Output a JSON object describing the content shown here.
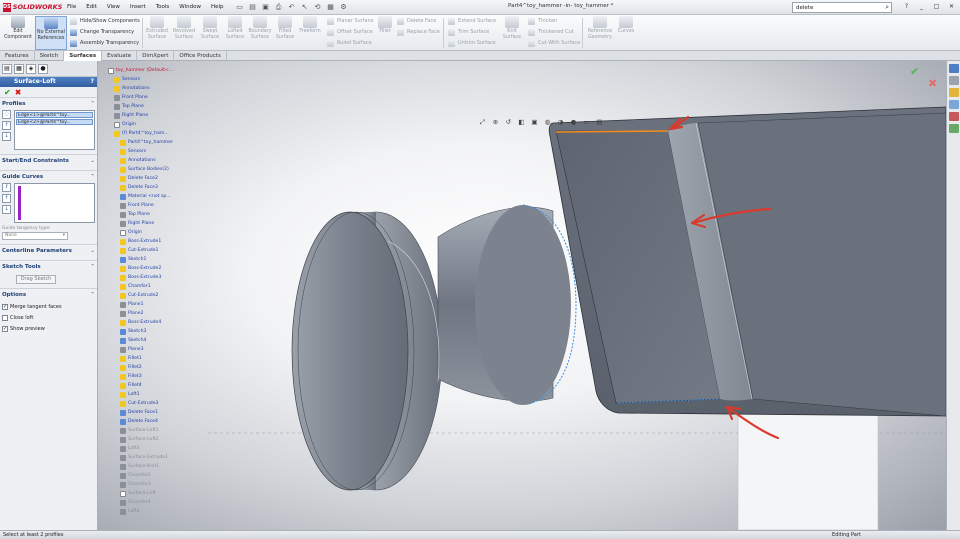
{
  "app": {
    "logo_text": "SOLIDWORKS",
    "window_title": "Part4^toy_hammer -in- toy_hammer *",
    "menu": [
      "File",
      "Edit",
      "View",
      "Insert",
      "Tools",
      "Window",
      "Help"
    ],
    "search_value": "delete",
    "window_buttons": [
      "?",
      "_",
      "□",
      "✕"
    ]
  },
  "command_manager": {
    "edit_component": "Edit Component",
    "no_external_refs": "No External References",
    "hide_show": "Hide/Show Components",
    "change_transparency": "Change Transparency",
    "assembly_transparency": "Assembly Transparency",
    "extruded_surface": "Extruded Surface",
    "revolved_surface": "Revolved Surface",
    "swept_surface": "Swept Surface",
    "lofted_surface": "Lofted Surface",
    "boundary_surface": "Boundary Surface",
    "filled_surface": "Filled Surface",
    "freeform": "Freeform",
    "planar_surface": "Planar Surface",
    "offset_surface": "Offset Surface",
    "ruled_surface": "Ruled Surface",
    "fillet": "Fillet",
    "delete_face": "Delete Face",
    "replace_face": "Replace Face",
    "extend_surface": "Extend Surface",
    "trim_surface": "Trim Surface",
    "untrim_surface": "Untrim Surface",
    "knit_surface": "Knit Surface",
    "thicken": "Thicken",
    "thickened_cut": "Thickened Cut",
    "cut_with_surface": "Cut With Surface",
    "reference_geometry": "Reference Geometry",
    "curves": "Curves"
  },
  "tabs": [
    "Features",
    "Sketch",
    "Surfaces",
    "Evaluate",
    "DimXpert",
    "Office Products"
  ],
  "active_tab": "Surfaces",
  "property_manager": {
    "title": "Surface-Loft",
    "help": "?",
    "profiles_header": "Profiles",
    "profiles": [
      "Edge<1>@Part4^toy...",
      "Edge<2>@Part4^toy..."
    ],
    "start_end_header": "Start/End Constraints",
    "guide_curves_header": "Guide Curves",
    "guide_influence_label": "Guide tangency type:",
    "guide_influence_value": "None",
    "centerline_header": "Centerline Parameters",
    "sketch_tools_header": "Sketch Tools",
    "drag_sketch": "Drag Sketch",
    "options_header": "Options",
    "options": [
      {
        "label": "Merge tangent faces",
        "checked": true
      },
      {
        "label": "Close loft",
        "checked": false
      },
      {
        "label": "Show preview",
        "checked": true
      }
    ]
  },
  "feature_tree": [
    {
      "label": "toy_hammer (Default<...",
      "icon": "w",
      "style": "hl"
    },
    {
      "label": "Sensors",
      "icon": "y",
      "style": "n"
    },
    {
      "label": "Annotations",
      "icon": "y",
      "style": "n"
    },
    {
      "label": "Front Plane",
      "icon": "g",
      "style": "n"
    },
    {
      "label": "Top Plane",
      "icon": "g",
      "style": "n"
    },
    {
      "label": "Right Plane",
      "icon": "g",
      "style": "n"
    },
    {
      "label": "Origin",
      "icon": "w",
      "style": "n"
    },
    {
      "label": "(f) Part4^toy_ham...",
      "icon": "y",
      "style": "n"
    },
    {
      "label": "Part4^toy_hammer",
      "icon": "y",
      "style": "n"
    },
    {
      "label": "Sensors",
      "icon": "y",
      "style": "n"
    },
    {
      "label": "Annotations",
      "icon": "y",
      "style": "n"
    },
    {
      "label": "Surface Bodies(2)",
      "icon": "y",
      "style": "n"
    },
    {
      "label": "Delete Face2",
      "icon": "y",
      "style": "n"
    },
    {
      "label": "Delete Face3",
      "icon": "y",
      "style": "n"
    },
    {
      "label": "Material <not sp...",
      "icon": "b",
      "style": "n"
    },
    {
      "label": "Front Plane",
      "icon": "g",
      "style": "n"
    },
    {
      "label": "Top Plane",
      "icon": "g",
      "style": "n"
    },
    {
      "label": "Right Plane",
      "icon": "g",
      "style": "n"
    },
    {
      "label": "Origin",
      "icon": "w",
      "style": "n"
    },
    {
      "label": "Boss-Extrude1",
      "icon": "y",
      "style": "n"
    },
    {
      "label": "Cut-Extrude1",
      "icon": "y",
      "style": "n"
    },
    {
      "label": "Sketch1",
      "icon": "b",
      "style": "n"
    },
    {
      "label": "Boss-Extrude2",
      "icon": "y",
      "style": "n"
    },
    {
      "label": "Boss-Extrude3",
      "icon": "y",
      "style": "n"
    },
    {
      "label": "Chamfer1",
      "icon": "y",
      "style": "n"
    },
    {
      "label": "Cut-Extrude2",
      "icon": "y",
      "style": "n"
    },
    {
      "label": "Plane1",
      "icon": "g",
      "style": "n"
    },
    {
      "label": "Plane2",
      "icon": "g",
      "style": "n"
    },
    {
      "label": "Boss-Extrude4",
      "icon": "y",
      "style": "n"
    },
    {
      "label": "Sketch3",
      "icon": "b",
      "style": "n"
    },
    {
      "label": "Sketch4",
      "icon": "b",
      "style": "n"
    },
    {
      "label": "Plane3",
      "icon": "g",
      "style": "n"
    },
    {
      "label": "Fillet1",
      "icon": "y",
      "style": "n"
    },
    {
      "label": "Fillet2",
      "icon": "y",
      "style": "n"
    },
    {
      "label": "Fillet3",
      "icon": "y",
      "style": "n"
    },
    {
      "label": "Fillet4",
      "icon": "y",
      "style": "n"
    },
    {
      "label": "Loft1",
      "icon": "y",
      "style": "n"
    },
    {
      "label": "Cut-Extrude3",
      "icon": "y",
      "style": "n"
    },
    {
      "label": "Delete Face1",
      "icon": "b",
      "style": "n"
    },
    {
      "label": "Delete Face4",
      "icon": "b",
      "style": "n"
    },
    {
      "label": "Surface-Loft1",
      "icon": "g",
      "style": "f"
    },
    {
      "label": "Surface-Loft2",
      "icon": "g",
      "style": "f"
    },
    {
      "label": "Loft3",
      "icon": "g",
      "style": "f"
    },
    {
      "label": "Surface-Extrude1",
      "icon": "g",
      "style": "f"
    },
    {
      "label": "Surface-Knit1",
      "icon": "g",
      "style": "f"
    },
    {
      "label": "Chamfer2",
      "icon": "g",
      "style": "f"
    },
    {
      "label": "Chamfer3",
      "icon": "g",
      "style": "f"
    },
    {
      "label": "Surface-Loft",
      "icon": "w",
      "style": "f"
    },
    {
      "label": "Chamfer4",
      "icon": "g",
      "style": "f"
    },
    {
      "label": "Loft4",
      "icon": "g",
      "style": "f"
    }
  ],
  "status": {
    "left": "Select at least 2 profiles",
    "right": "Editing Part"
  },
  "colors": {
    "arrow": "#d93a2b",
    "highlight_edge": "#f08a1e",
    "preview_edge": "#2f86d8",
    "surface_dark": "#5d6470",
    "surface_light": "#aab0ba"
  }
}
